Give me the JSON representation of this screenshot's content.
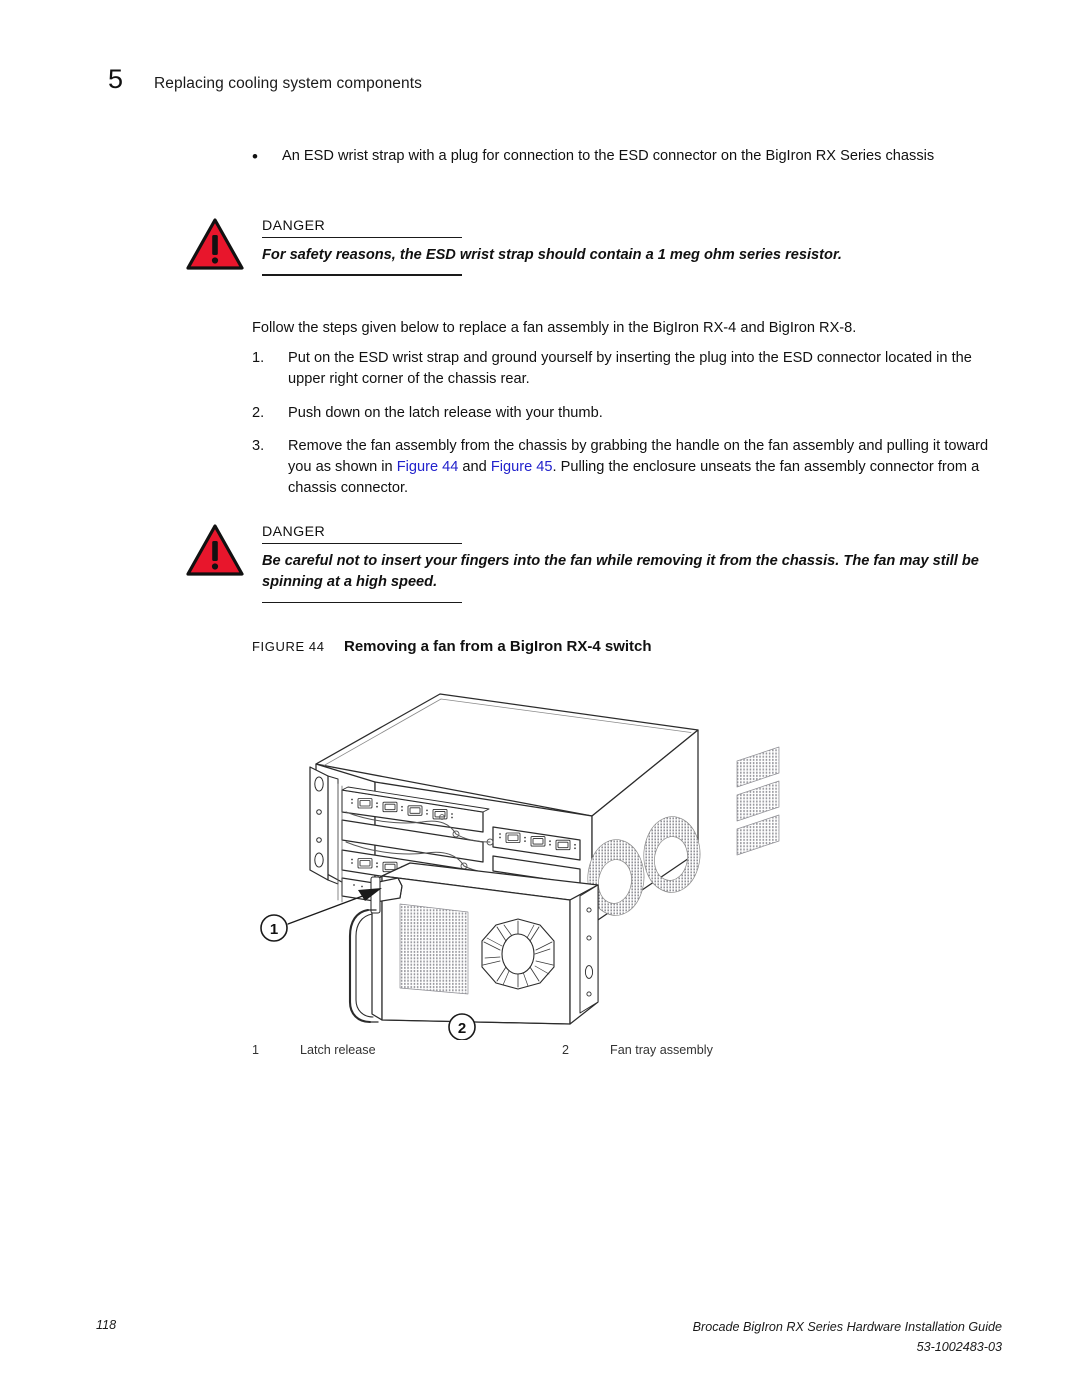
{
  "header": {
    "chapter_number": "5",
    "chapter_title": "Replacing cooling system components"
  },
  "bullet": {
    "marker": "•",
    "text": "An ESD wrist strap with a plug for connection to the ESD connector on the BigIron RX Series chassis"
  },
  "danger1": {
    "icon": "warning-triangle-icon",
    "label": "DANGER",
    "text": "For safety reasons, the ESD wrist strap should contain a 1 meg ohm series resistor.",
    "color": "#e8162c"
  },
  "intro": {
    "text": "Follow the steps given below to replace a fan assembly in the BigIron RX-4 and BigIron RX-8."
  },
  "steps": [
    {
      "number": "1.",
      "text": "Put on the ESD wrist strap and ground yourself by inserting the plug into the ESD connector located in the upper right corner of the chassis rear."
    },
    {
      "number": "2.",
      "text": "Push down on the latch release with your thumb."
    },
    {
      "number": "3.",
      "text_before": "Remove the fan assembly from the chassis by grabbing the handle on the fan assembly and pulling it toward you as shown in ",
      "xref1": "Figure 44",
      "text_mid": " and ",
      "xref2": "Figure 45",
      "text_after": ". Pulling the enclosure unseats the fan assembly connector from a chassis connector."
    }
  ],
  "danger2": {
    "icon": "warning-triangle-icon",
    "label": "DANGER",
    "text": "Be careful not to insert your fingers into the fan while removing it from the chassis. The fan may still be spinning at a high speed.",
    "color": "#e8162c"
  },
  "figure": {
    "label": "FIGURE 44",
    "title": "Removing a fan from a BigIron RX-4 switch",
    "callouts": [
      {
        "number": "1"
      },
      {
        "number": "2"
      }
    ],
    "legend": [
      {
        "number": "1",
        "text": "Latch release"
      },
      {
        "number": "2",
        "text": "Fan tray assembly"
      }
    ]
  },
  "footer": {
    "page_number": "118",
    "guide_title": "Brocade BigIron RX Series Hardware Installation Guide",
    "doc_number": "53-1002483-03"
  }
}
